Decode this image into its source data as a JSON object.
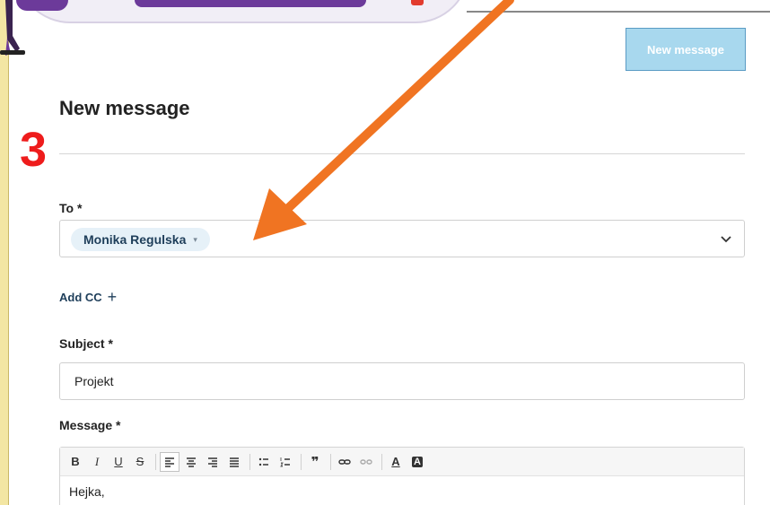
{
  "header": {
    "new_message_button": "New message"
  },
  "page": {
    "title": "New message",
    "step_number": "3"
  },
  "form": {
    "to_label": "To *",
    "recipient": "Monika Regulska",
    "add_cc": "Add CC",
    "subject_label": "Subject *",
    "subject_value": "Projekt",
    "message_label": "Message *",
    "message_first_line": "Hejka,"
  },
  "toolbar": {
    "bold": "B",
    "italic": "I",
    "underline": "U",
    "strike": "S",
    "quote": "❞",
    "text_color": "A",
    "bg_color": "A"
  },
  "colors": {
    "accent": "#6c3a9a",
    "button_bg": "#a8d8ee",
    "step_red": "#ee1c1c",
    "arrow": "#f07422",
    "chip_bg": "#e6f1f8"
  },
  "icons": [
    "chevron-down-icon",
    "plus-icon",
    "bold-icon",
    "italic-icon",
    "underline-icon",
    "strikethrough-icon",
    "align-left-icon",
    "align-center-icon",
    "align-right-icon",
    "align-justify-icon",
    "bulleted-list-icon",
    "numbered-list-icon",
    "quote-icon",
    "link-icon",
    "unlink-icon",
    "text-color-icon",
    "background-color-icon",
    "arrow-annotation-icon"
  ]
}
